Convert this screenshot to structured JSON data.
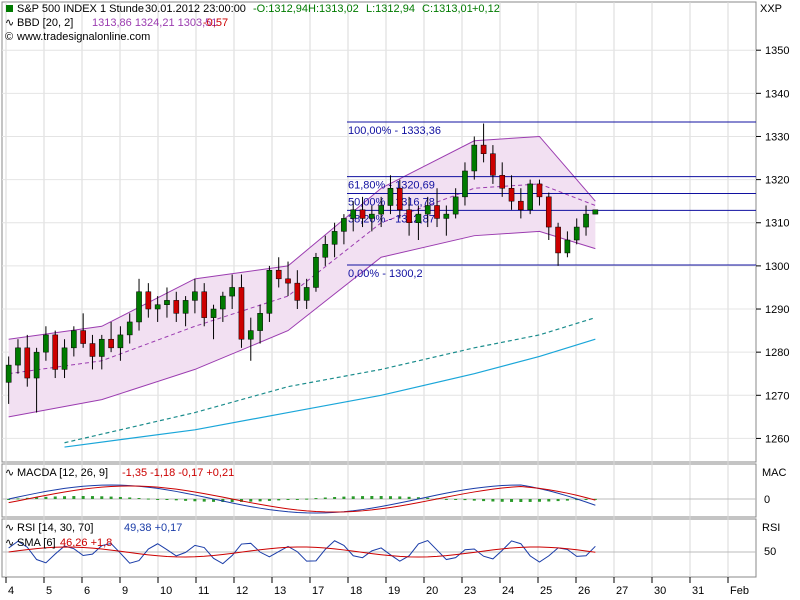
{
  "chart_data": [
    {
      "type": "candlestick",
      "panel": "price",
      "header": {
        "symbol": "S&P 500 INDEX 1 Stunde",
        "datetime": "30.01.2012 23:00:00",
        "o": "-O:1312,94",
        "h": "H:1313,02",
        "l": "L:1312,94",
        "c": "C:1313,01",
        "chg": "+0,12"
      },
      "indicator_label": "BBD [20, 2]",
      "indicator_values": "1313,86 1324,21 1303,51",
      "indicator_chg": "-0,57",
      "source": "www.tradesignalonline.com",
      "axis_label": "XXP",
      "ylim": [
        1255,
        1357
      ],
      "yticks": [
        "1350",
        "1340",
        "1330",
        "1320",
        "1310",
        "1300",
        "1290",
        "1280",
        "1270",
        "1260"
      ],
      "fib_levels": [
        {
          "label": "100,00% - 1333,36",
          "value": 1333.36
        },
        {
          "label": "61,80% - 1320,69",
          "value": 1320.69
        },
        {
          "label": "50,00% - 1316,78",
          "value": 1316.78
        },
        {
          "label": "38,20% - 1312,87",
          "value": 1312.87
        },
        {
          "label": "0,00% - 1300,2",
          "value": 1300.2
        }
      ],
      "candles": [
        [
          1273,
          1279,
          1268,
          1277
        ],
        [
          1277,
          1283,
          1275,
          1281
        ],
        [
          1281,
          1284,
          1272,
          1274
        ],
        [
          1274,
          1281,
          1266,
          1280
        ],
        [
          1280,
          1286,
          1278,
          1284
        ],
        [
          1284,
          1285,
          1274,
          1276
        ],
        [
          1276,
          1283,
          1274,
          1281
        ],
        [
          1281,
          1286,
          1279,
          1285
        ],
        [
          1285,
          1289,
          1281,
          1282
        ],
        [
          1282,
          1284,
          1276,
          1279
        ],
        [
          1279,
          1284,
          1276,
          1283
        ],
        [
          1283,
          1287,
          1280,
          1281
        ],
        [
          1281,
          1286,
          1278,
          1284
        ],
        [
          1284,
          1289,
          1282,
          1287
        ],
        [
          1287,
          1297,
          1285,
          1294
        ],
        [
          1294,
          1296,
          1288,
          1290
        ],
        [
          1290,
          1293,
          1287,
          1291
        ],
        [
          1291,
          1295,
          1288,
          1292
        ],
        [
          1292,
          1294,
          1287,
          1289
        ],
        [
          1289,
          1293,
          1286,
          1292
        ],
        [
          1292,
          1297,
          1289,
          1294
        ],
        [
          1294,
          1296,
          1286,
          1288
        ],
        [
          1288,
          1291,
          1283,
          1290
        ],
        [
          1290,
          1294,
          1287,
          1293
        ],
        [
          1293,
          1298,
          1290,
          1295
        ],
        [
          1295,
          1298,
          1281,
          1283
        ],
        [
          1283,
          1288,
          1278,
          1285
        ],
        [
          1285,
          1291,
          1282,
          1289
        ],
        [
          1289,
          1300,
          1287,
          1299
        ],
        [
          1299,
          1302,
          1295,
          1297
        ],
        [
          1297,
          1301,
          1293,
          1296
        ],
        [
          1296,
          1299,
          1290,
          1292
        ],
        [
          1292,
          1297,
          1290,
          1295
        ],
        [
          1295,
          1303,
          1294,
          1302
        ],
        [
          1302,
          1307,
          1300,
          1305
        ],
        [
          1305,
          1310,
          1302,
          1308
        ],
        [
          1308,
          1312,
          1305,
          1311
        ],
        [
          1311,
          1315,
          1308,
          1313
        ],
        [
          1313,
          1316,
          1309,
          1311
        ],
        [
          1311,
          1314,
          1308,
          1312
        ],
        [
          1312,
          1316,
          1309,
          1314
        ],
        [
          1314,
          1321,
          1312,
          1318
        ],
        [
          1318,
          1320,
          1311,
          1313
        ],
        [
          1313,
          1316,
          1307,
          1310
        ],
        [
          1310,
          1314,
          1306,
          1312
        ],
        [
          1312,
          1316,
          1309,
          1314
        ],
        [
          1314,
          1318,
          1309,
          1311
        ],
        [
          1311,
          1314,
          1307,
          1312
        ],
        [
          1312,
          1318,
          1311,
          1316
        ],
        [
          1316,
          1324,
          1314,
          1322
        ],
        [
          1322,
          1330,
          1320,
          1328
        ],
        [
          1328,
          1333,
          1324,
          1326
        ],
        [
          1326,
          1328,
          1319,
          1321
        ],
        [
          1321,
          1324,
          1316,
          1318
        ],
        [
          1318,
          1321,
          1313,
          1315
        ],
        [
          1315,
          1318,
          1311,
          1313
        ],
        [
          1313,
          1320,
          1312,
          1319
        ],
        [
          1319,
          1320,
          1314,
          1316
        ],
        [
          1316,
          1317,
          1306,
          1309
        ],
        [
          1309,
          1310,
          1300,
          1303
        ],
        [
          1303,
          1308,
          1302,
          1306
        ],
        [
          1306,
          1311,
          1305,
          1309
        ],
        [
          1309,
          1314,
          1307,
          1312
        ],
        [
          1312,
          1313,
          1312,
          1313
        ]
      ],
      "bollinger": {
        "upper": [
          [
            0,
            1283
          ],
          [
            10,
            1286
          ],
          [
            20,
            1297
          ],
          [
            30,
            1300
          ],
          [
            40,
            1318
          ],
          [
            50,
            1329
          ],
          [
            57,
            1330
          ],
          [
            63,
            1315
          ]
        ],
        "middle": [
          [
            0,
            1275
          ],
          [
            10,
            1278
          ],
          [
            20,
            1286
          ],
          [
            30,
            1293
          ],
          [
            40,
            1310
          ],
          [
            50,
            1318
          ],
          [
            57,
            1319
          ],
          [
            63,
            1314
          ]
        ],
        "lower": [
          [
            0,
            1265
          ],
          [
            10,
            1269
          ],
          [
            20,
            1276
          ],
          [
            30,
            1285
          ],
          [
            40,
            1302
          ],
          [
            50,
            1307
          ],
          [
            57,
            1308
          ],
          [
            63,
            1304
          ]
        ]
      },
      "sma_long": [
        [
          6,
          1258
        ],
        [
          20,
          1262
        ],
        [
          30,
          1266
        ],
        [
          40,
          1270
        ],
        [
          50,
          1275
        ],
        [
          57,
          1279
        ],
        [
          63,
          1283
        ]
      ],
      "sma_dashed": [
        [
          6,
          1259
        ],
        [
          20,
          1266
        ],
        [
          30,
          1272
        ],
        [
          40,
          1276
        ],
        [
          50,
          1281
        ],
        [
          57,
          1284
        ],
        [
          63,
          1288
        ]
      ]
    },
    {
      "type": "line",
      "panel": "macd",
      "label": "MACDA [12, 26, 9]",
      "values": "-1,35 -1,18 -0,17 +0,21",
      "axis_label": "MAC",
      "ytick": "0"
    },
    {
      "type": "line",
      "panel": "rsi",
      "label1": "RSI [14, 30, 70]",
      "values1": "49,38 +0,17",
      "label2": "SMA [6]",
      "values2": "46,26 +1,8",
      "axis_label": "RSI",
      "ytick": "50"
    }
  ],
  "x_axis": {
    "ticks": [
      "4",
      "5",
      "6",
      "9",
      "10",
      "11",
      "12",
      "13",
      "17",
      "18",
      "19",
      "20",
      "23",
      "24",
      "25",
      "26",
      "27",
      "30",
      "31",
      "Feb"
    ]
  },
  "colors": {
    "candle_up": "#007a00",
    "candle_down": "#cc0000",
    "bb_fill": "#f2e0f2",
    "bb_line": "#9b3cb0",
    "fib": "#1010a0",
    "sma_long": "#1aa6d9",
    "sma_dash": "#1a8c8c"
  }
}
